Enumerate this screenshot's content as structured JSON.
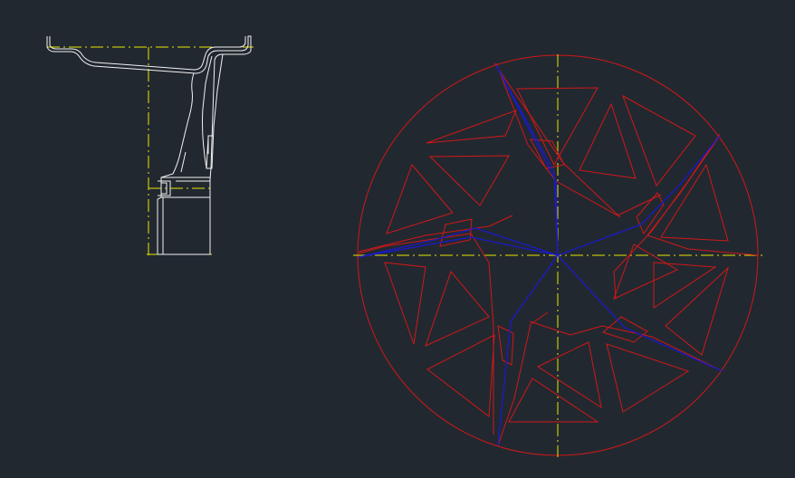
{
  "drawing": {
    "background": "#222830",
    "colors": {
      "profile": "#f2f2f2",
      "centerline": "#e6e600",
      "spoke_outline": "#d01818",
      "spoke_ridge": "#1a1ac8"
    },
    "views": [
      "rim-section-view",
      "wheel-face-view"
    ],
    "spoke_count": 5
  }
}
